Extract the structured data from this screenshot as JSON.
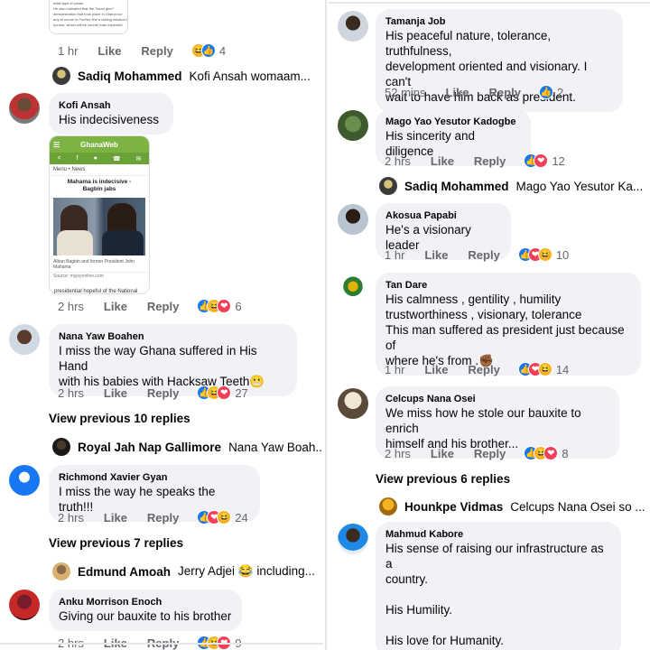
{
  "left": {
    "top_snippet": {
      "lines": [
        "what type of power.",
        "He also indicated that the Twum gbe?",
        "demonstration that took place in Ghana nor",
        "any-el ecrum in Further find a lasting solution to",
        "hprosa, which will be sooner than expected"
      ],
      "time": "1 hr",
      "like": "Like",
      "reply": "Reply",
      "count": "4"
    },
    "reply_sadiq": {
      "name": "Sadiq Mohammed",
      "text": "Kofi Ansah  womaam..."
    },
    "comments": [
      {
        "name": "Kofi Ansah",
        "text": "His indecisiveness",
        "time": "2 hrs",
        "like": "Like",
        "reply": "Reply",
        "count": "6",
        "attachment": {
          "site": "GhanaWeb",
          "crumb": "Menu • News",
          "headline": "Mahama is indecisive - Bagbin jabs",
          "caption": "Alban Bagbin and former President John Mahama",
          "source": "Source: myjoyonline.com",
          "below": "presidential hopeful of the National"
        }
      },
      {
        "name": "Nana Yaw Boahen",
        "text_lines": [
          "I miss the way Ghana suffered in His Hand",
          "with his babies with Hacksaw Teeth😬"
        ],
        "time": "2 hrs",
        "like": "Like",
        "reply": "Reply",
        "count": "27"
      },
      {
        "name": "Richmond Xavier Gyan",
        "text": "I miss the way he speaks the truth!!!",
        "time": "2 hrs",
        "like": "Like",
        "reply": "Reply",
        "count": "24"
      },
      {
        "name": "Anku Morrison Enoch",
        "text": "Giving our bauxite to his brother",
        "time": "2 hrs",
        "like": "Like",
        "reply": "Reply",
        "count": "9"
      }
    ],
    "view_prev_1": "View previous 10 replies",
    "reply_royal": {
      "name": "Royal Jah Nap Gallimore",
      "text": "Nana Yaw Boah..."
    },
    "view_prev_2": "View previous 7 replies",
    "reply_edmund": {
      "name": "Edmund Amoah",
      "text": "Jerry Adjei 😂 including..."
    }
  },
  "right": {
    "comments": [
      {
        "name": "Tamanja Job",
        "text_lines": [
          "His peaceful nature, tolerance, truthfulness,",
          "development oriented and visionary. I can't",
          "wait to have him back as president."
        ],
        "time": "52 mins",
        "like": "Like",
        "reply": "Reply",
        "count": "2"
      },
      {
        "name": "Mago Yao Yesutor Kadogbe",
        "text": "His sincerity and diligence",
        "time": "2 hrs",
        "like": "Like",
        "reply": "Reply",
        "count": "12"
      },
      {
        "name": "Akosua Papabi",
        "text": "He's a visionary leader",
        "time": "1 hr",
        "like": "Like",
        "reply": "Reply",
        "count": "10"
      },
      {
        "name": "Tan Dare",
        "text_lines": [
          "His calmness , gentility , humility",
          "trustworthiness , visionary, tolerance",
          "This man suffered as president just because of",
          "where he's from .✊🏾"
        ],
        "time": "1 hr",
        "like": "Like",
        "reply": "Reply",
        "count": "14"
      },
      {
        "name": "Celcups Nana Osei",
        "text_lines": [
          "We miss how he stole our bauxite to enrich",
          "himself and his brother..."
        ],
        "time": "2 hrs",
        "like": "Like",
        "reply": "Reply",
        "count": "8"
      },
      {
        "name": "Mahmud Kabore",
        "text_lines": [
          "His sense of raising our infrastructure as a",
          "country.",
          "",
          "His Humility.",
          "",
          "His love for Humanity."
        ]
      }
    ],
    "reply_sadiq": {
      "name": "Sadiq Mohammed",
      "text": "Mago Yao Yesutor Ka..."
    },
    "view_prev": "View previous 6 replies",
    "reply_hounkpe": {
      "name": "Hounkpe Vidmas",
      "text": "Celcups Nana Osei so ..."
    }
  },
  "reaction_icons": {
    "like": "👍",
    "love": "❤",
    "haha": "😆"
  },
  "colors": {
    "bubble": "#f0f2f5",
    "meta": "#65676b",
    "like_blue": "#1877f2",
    "love_red": "#f33e58",
    "haha_yellow": "#f7b125",
    "ghanaweb_green": "#7cb342"
  }
}
